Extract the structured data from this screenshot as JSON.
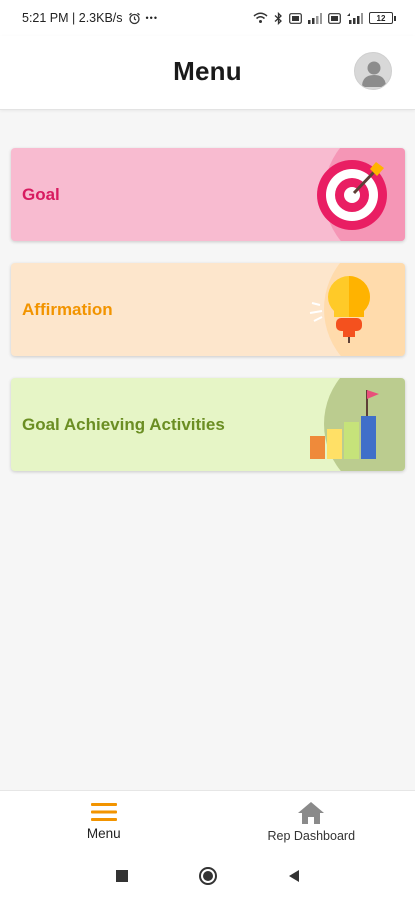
{
  "status_bar": {
    "time_speed": "5:21 PM | 2.3KB/s",
    "more_dots": "•••",
    "battery": "12"
  },
  "header": {
    "title": "Menu"
  },
  "menu_cards": [
    {
      "label": "Goal",
      "label_color": "#d81b60",
      "bg_color": "#f8bbd0",
      "art_icon": "target-icon"
    },
    {
      "label": "Affirmation",
      "label_color": "#f29400",
      "bg_color": "#fde6cc",
      "art_icon": "lightbulb-icon"
    },
    {
      "label": "Goal Achieving Activities",
      "label_color": "#6b8e23",
      "bg_color": "#e6f5c6",
      "art_icon": "growth-chart-flag-icon"
    }
  ],
  "bottom_nav": {
    "items": [
      {
        "label": "Menu",
        "icon": "hamburger-menu-icon",
        "active": true,
        "color": "#f29400"
      },
      {
        "label": "Rep Dashboard",
        "icon": "home-icon",
        "active": false,
        "color": "#8a8a8a"
      }
    ]
  },
  "system_nav": {
    "icons": [
      "recents-square-icon",
      "home-circle-icon",
      "back-triangle-icon"
    ]
  }
}
